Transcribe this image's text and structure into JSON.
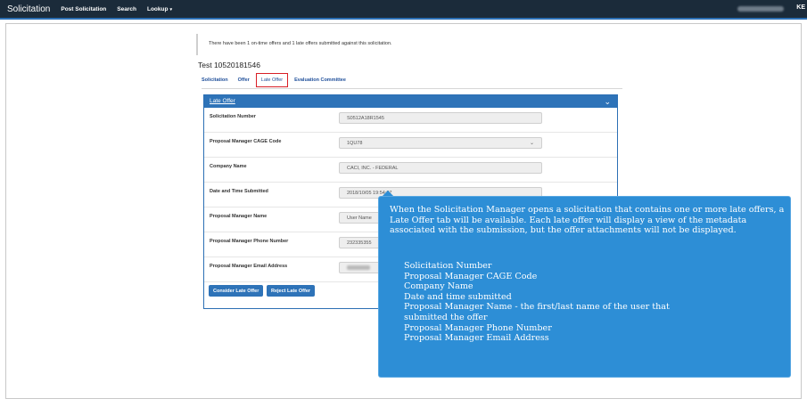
{
  "topnav": {
    "brand": "Solicitation",
    "items": [
      {
        "label": "Post Solicitation"
      },
      {
        "label": "Search"
      },
      {
        "label": "Lookup"
      }
    ],
    "user_short": "KE"
  },
  "notice": "There have been 1 on-time offers and 1 late offers submitted against this solicitation.",
  "page_title": "Test 10520181546",
  "tabs": [
    {
      "label": "Solicitation"
    },
    {
      "label": "Offer"
    },
    {
      "label": "Late Offer"
    },
    {
      "label": "Evaluation Committee"
    }
  ],
  "panel": {
    "title": "Late Offer",
    "fields": [
      {
        "label": "Solicitation Number",
        "value": "S0512A18R1545"
      },
      {
        "label": "Proposal Manager CAGE Code",
        "value": "1QU78"
      },
      {
        "label": "Company Name",
        "value": "CACI, INC. - FEDERAL"
      },
      {
        "label": "Date and Time Submitted",
        "value": "2018/10/05 19:54:37"
      },
      {
        "label": "Proposal Manager Name",
        "value": "User Name"
      },
      {
        "label": "Proposal Manager Phone Number",
        "value": "232335355"
      },
      {
        "label": "Proposal Manager Email Address",
        "value": ""
      }
    ],
    "buttons": {
      "consider": "Consider Late Offer",
      "reject": "Reject Late Offer"
    }
  },
  "callout": {
    "intro": "When the Solicitation Manager opens a solicitation that contains one or more late offers, a Late Offer tab will be available. Each late offer will display a view of the metadata associated with the submission, but the offer attachments will not be displayed.",
    "items": [
      "Solicitation Number",
      "Proposal Manager CAGE Code",
      "Company Name",
      "Date and time submitted",
      "Proposal Manager Name - the first/last name of the user that",
      "submitted the offer",
      "Proposal Manager Phone Number",
      "Proposal Manager Email Address"
    ]
  }
}
